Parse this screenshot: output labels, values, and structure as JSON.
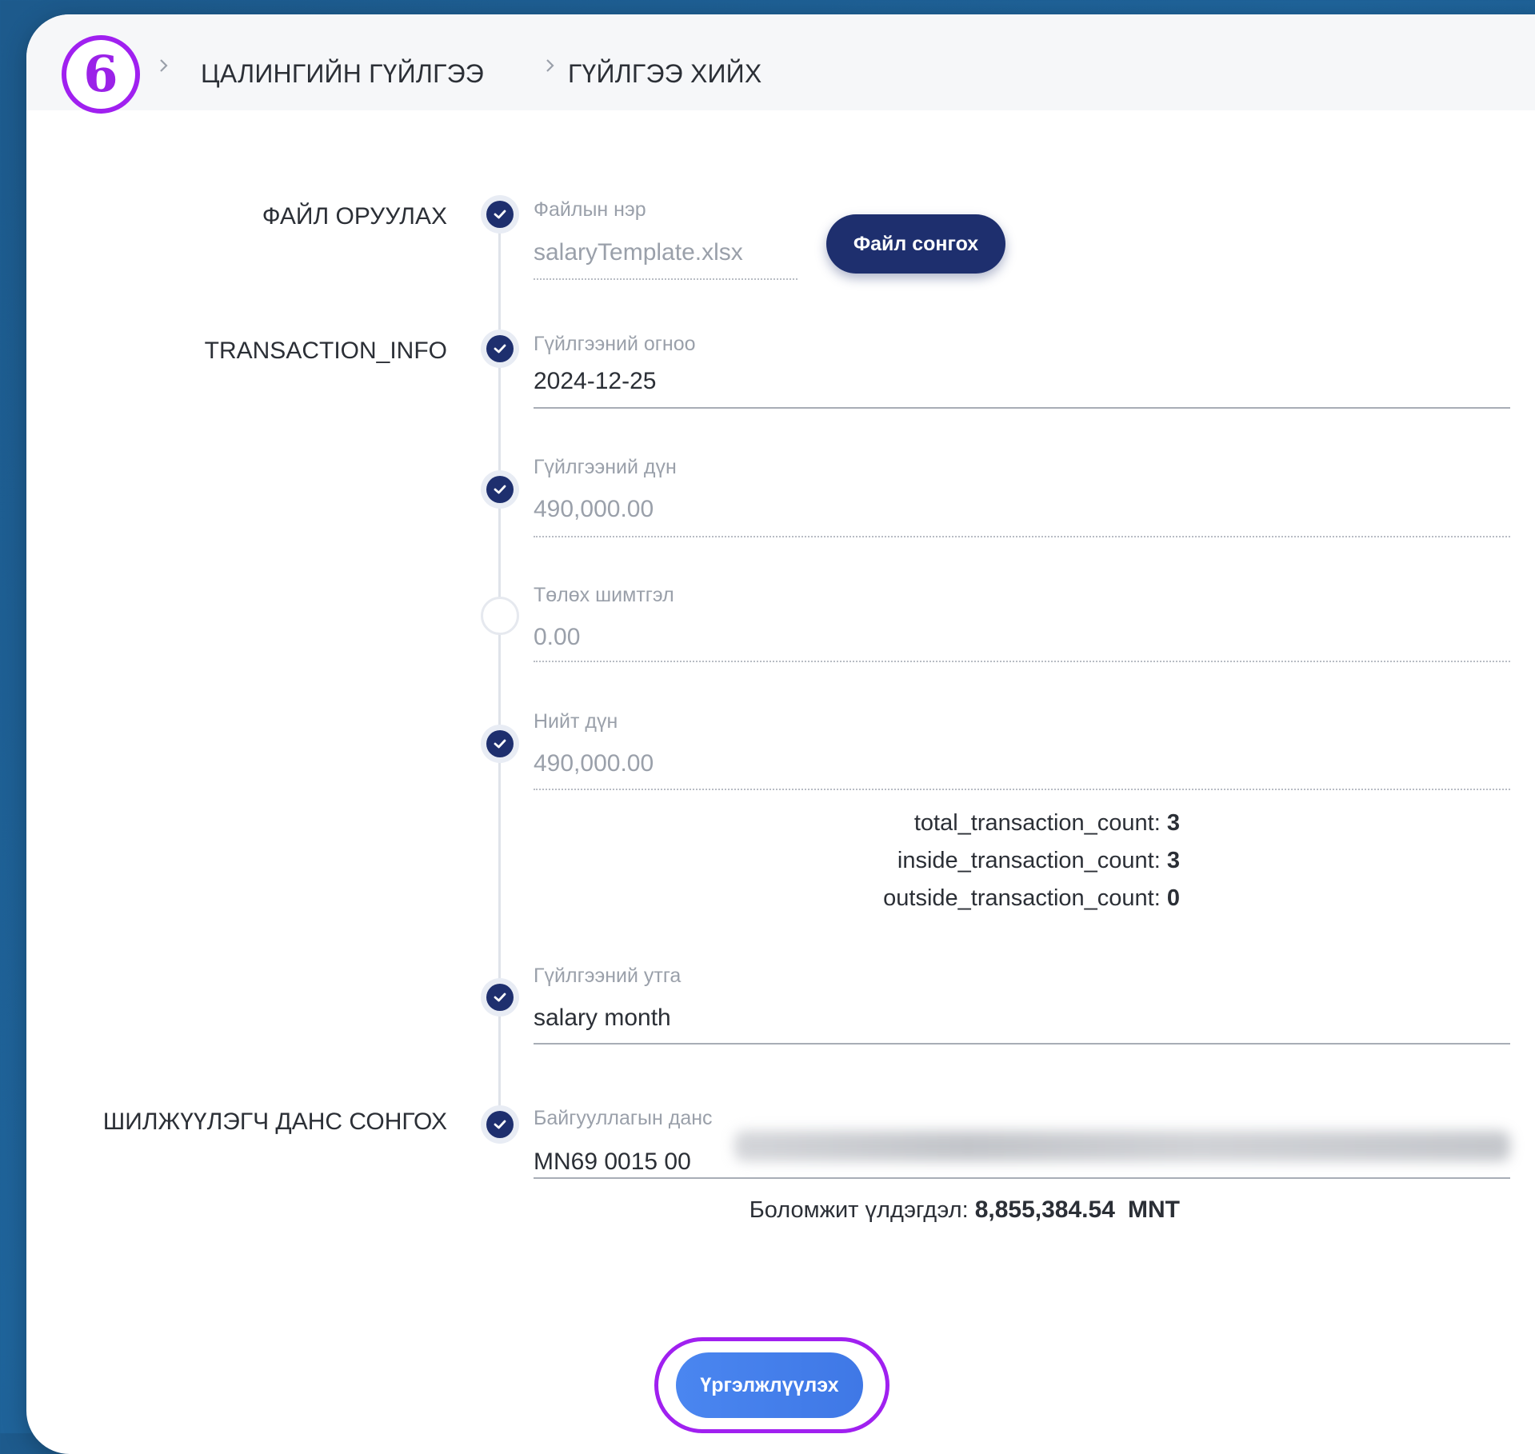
{
  "step_number": "6",
  "breadcrumb": {
    "items": [
      "ЦАЛИНГИЙН ГҮЙЛГЭЭ",
      "ГҮЙЛГЭЭ ХИЙХ"
    ]
  },
  "sections": {
    "file_upload": "ФАЙЛ ОРУУЛАХ",
    "transaction_info": "TRANSACTION_INFO",
    "source_account": "ШИЛЖҮҮЛЭГЧ ДАНС СОНГОХ"
  },
  "fields": {
    "file_name": {
      "label": "Файлын нэр",
      "value": "salaryTemplate.xlsx"
    },
    "transaction_date": {
      "label": "Гүйлгээний огноо",
      "value": "2024-12-25"
    },
    "transaction_amount": {
      "label": "Гүйлгээний дүн",
      "value": "490,000.00"
    },
    "fee": {
      "label": "Төлөх шимтгэл",
      "value": "0.00"
    },
    "total_amount": {
      "label": "Нийт дүн",
      "value": "490,000.00"
    },
    "description": {
      "label": "Гүйлгээний утга",
      "value": "salary month"
    },
    "org_account": {
      "label": "Байгууллагын данс",
      "value": "MN69 0015 00"
    }
  },
  "buttons": {
    "choose_file": "Файл сонгох",
    "continue": "Үргэлжлүүлэх"
  },
  "counts": {
    "total_label": "total_transaction_count:",
    "total_value": "3",
    "inside_label": "inside_transaction_count:",
    "inside_value": "3",
    "outside_label": "outside_transaction_count:",
    "outside_value": "0"
  },
  "balance": {
    "label": "Боломжит үлдэгдэл:",
    "amount": "8,855,384.54",
    "currency": "MNT"
  },
  "colors": {
    "highlight": "#a020f0",
    "primary": "#1e2f6e",
    "accent": "#4a86f0"
  },
  "icons": {
    "step_done": "check-circle-icon",
    "step_pending": "empty-circle-icon",
    "separator": "chevron-right-icon"
  }
}
